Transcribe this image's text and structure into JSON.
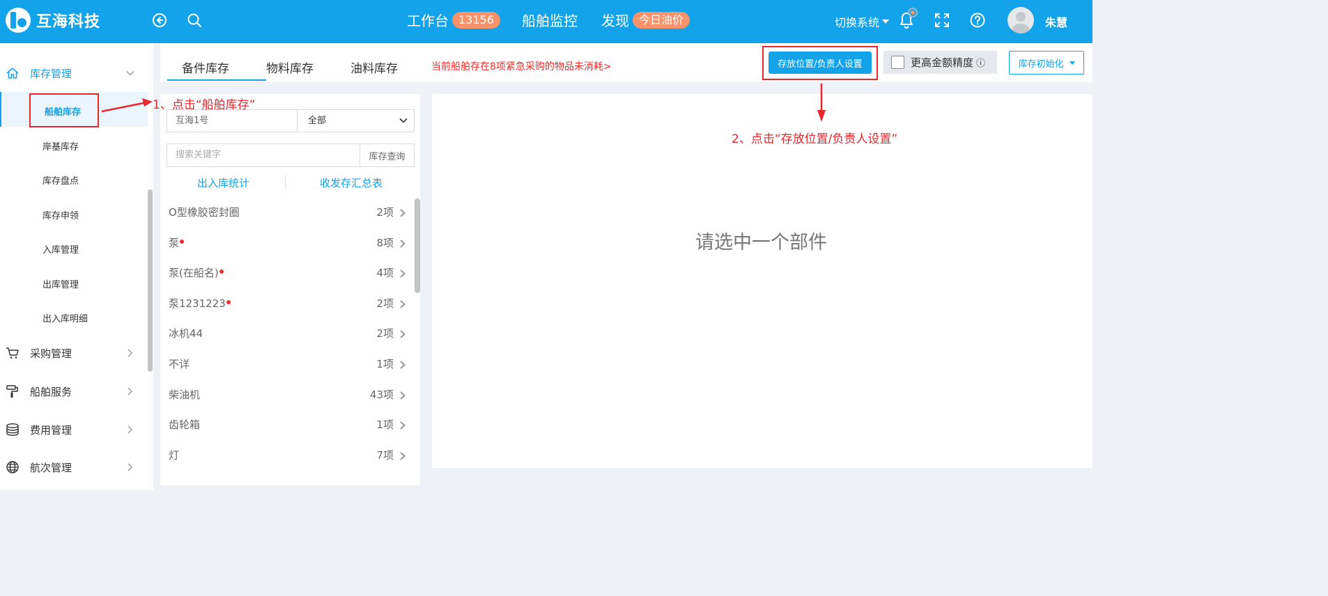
{
  "header": {
    "brand": "互海科技",
    "nav": [
      {
        "label": "工作台",
        "badge": "13156"
      },
      {
        "label": "船舶监控"
      },
      {
        "label": "发现",
        "badge": "今日油价"
      }
    ],
    "switch_system": "切换系统",
    "username": "朱慧",
    "icons": [
      "back-circle-icon",
      "search-icon",
      "bell-icon",
      "fullscreen-icon",
      "help-icon"
    ]
  },
  "sidebar": {
    "groups": [
      {
        "label": "库存管理",
        "icon": "home-icon",
        "expanded": true
      },
      {
        "label": "采购管理",
        "icon": "cart-icon"
      },
      {
        "label": "船舶服务",
        "icon": "paint-roller-icon"
      },
      {
        "label": "费用管理",
        "icon": "coins-stack-icon"
      },
      {
        "label": "航次管理",
        "icon": "globe-icon"
      }
    ],
    "items": [
      "船舶库存",
      "岸基库存",
      "库存盘点",
      "库存申领",
      "入库管理",
      "出库管理",
      "出入库明细"
    ],
    "active_item": "船舶库存"
  },
  "tabs": {
    "items": [
      "备件库存",
      "物料库存",
      "油料库存"
    ],
    "active": "备件库存",
    "warning": "当前船舶存在8项紧急采购的物品未消耗>"
  },
  "toolbar": {
    "location_button": "存放位置/负责人设置",
    "precision_label": "更高金额精度",
    "precision_info": "ⓘ",
    "init_button": "库存初始化"
  },
  "filter": {
    "ship": "互海1号",
    "category": "全部",
    "search_placeholder": "搜索关键字",
    "search_button": "库存查询",
    "link_stats": "出入库统计",
    "link_summary": "收发存汇总表"
  },
  "parts": [
    {
      "name": "O型橡胶密封圈",
      "count": "2项",
      "flag": false
    },
    {
      "name": "泵",
      "count": "8项",
      "flag": true
    },
    {
      "name": "泵(在船名)",
      "count": "4项",
      "flag": true
    },
    {
      "name": "泵1231223",
      "count": "2项",
      "flag": true
    },
    {
      "name": "冰机44",
      "count": "2项",
      "flag": false
    },
    {
      "name": "不详",
      "count": "1项",
      "flag": false
    },
    {
      "name": "柴油机",
      "count": "43项",
      "flag": false
    },
    {
      "name": "齿轮箱",
      "count": "1项",
      "flag": false
    },
    {
      "name": "灯",
      "count": "7项",
      "flag": false
    }
  ],
  "detail": {
    "empty_text": "请选中一个部件"
  },
  "annotations": {
    "step1": "1、点击“船舶库存”",
    "step2": "2、点击“存放位置/负责人设置”"
  },
  "colors": {
    "brand": "#12a3ea",
    "badge": "#f7926a",
    "warning": "#f02b2b",
    "annotation": "#e6282d"
  }
}
